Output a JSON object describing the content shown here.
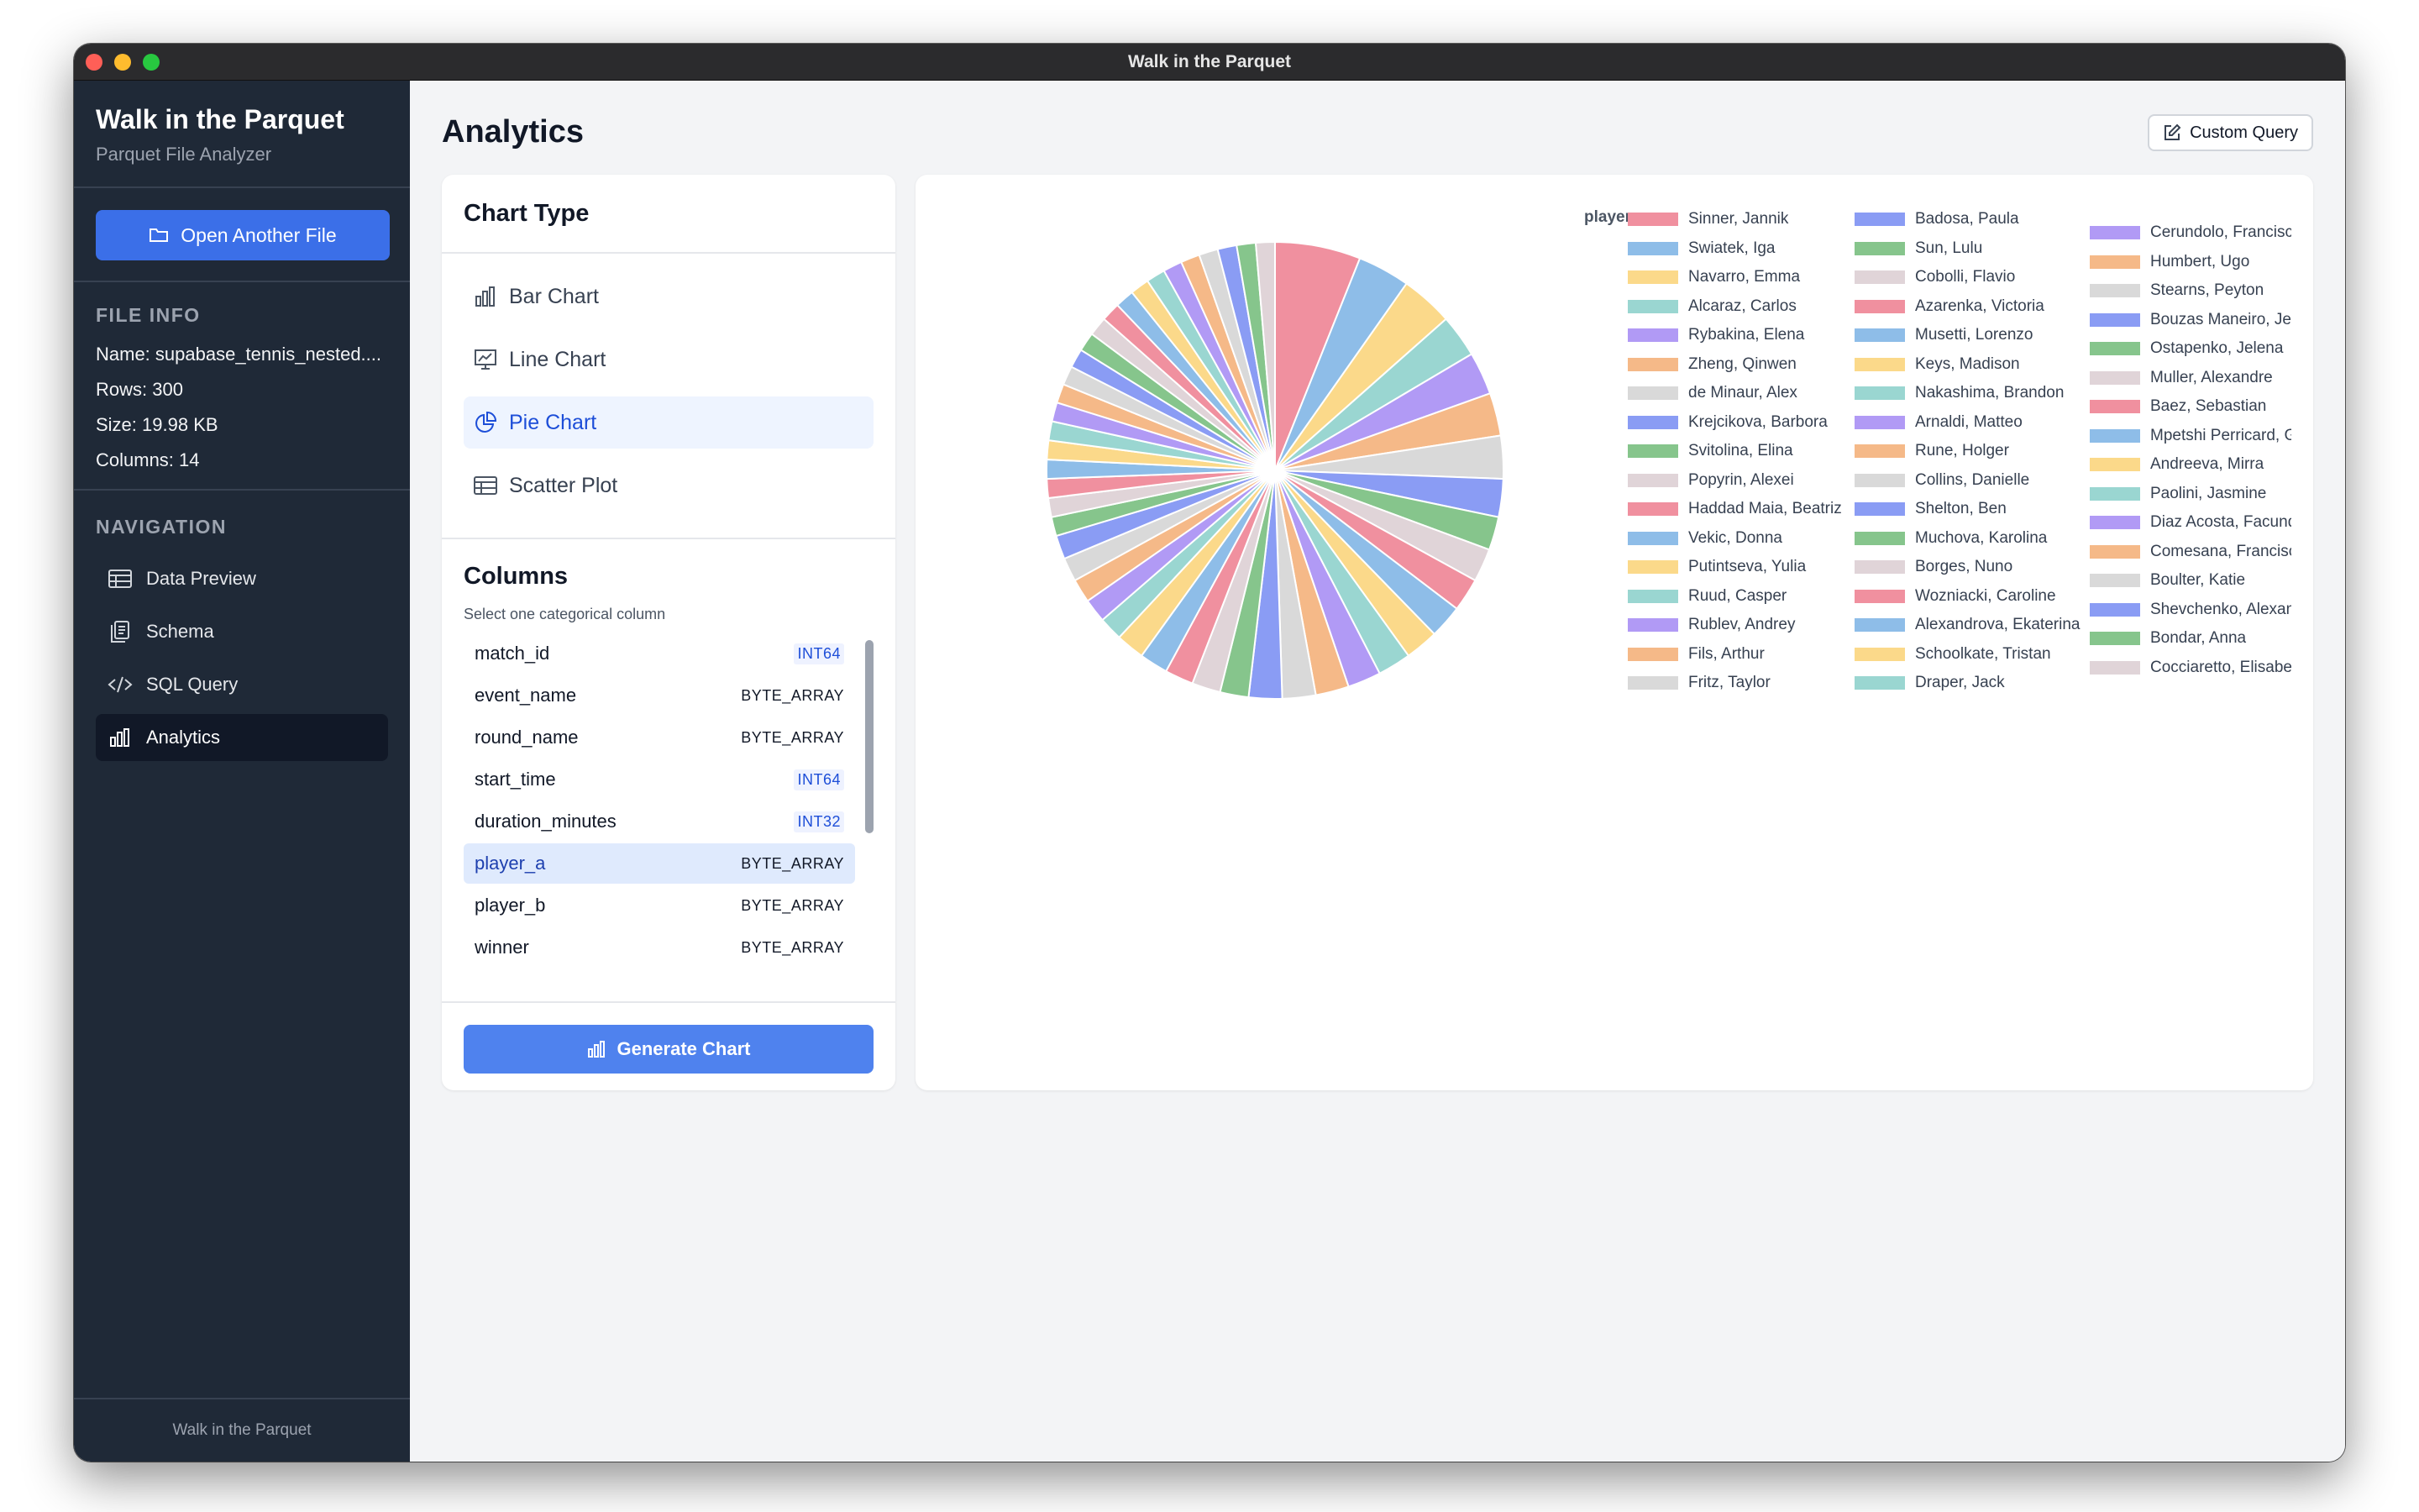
{
  "window": {
    "title": "Walk in the Parquet"
  },
  "sidebar": {
    "title": "Walk in the Parquet",
    "subtitle": "Parquet File Analyzer",
    "open_button": "Open Another File",
    "file_info_title": "FILE INFO",
    "file_info": {
      "name": "Name: supabase_tennis_nested....",
      "rows": "Rows: 300",
      "size": "Size: 19.98 KB",
      "columns": "Columns: 14"
    },
    "nav_title": "NAVIGATION",
    "nav": [
      {
        "label": "Data Preview",
        "icon": "table-icon"
      },
      {
        "label": "Schema",
        "icon": "document-icon"
      },
      {
        "label": "SQL Query",
        "icon": "code-icon"
      },
      {
        "label": "Analytics",
        "icon": "bar-chart-icon",
        "active": true
      }
    ],
    "footer": "Walk in the Parquet"
  },
  "main": {
    "title": "Analytics",
    "custom_query": "Custom Query",
    "chart_type": {
      "title": "Chart Type",
      "options": [
        {
          "label": "Bar Chart",
          "icon": "bar-chart-icon"
        },
        {
          "label": "Line Chart",
          "icon": "line-chart-icon"
        },
        {
          "label": "Pie Chart",
          "icon": "pie-chart-icon",
          "active": true
        },
        {
          "label": "Scatter Plot",
          "icon": "table-icon"
        }
      ]
    },
    "columns": {
      "title": "Columns",
      "subtitle": "Select one categorical column",
      "items": [
        {
          "name": "match_id",
          "type": "INT64"
        },
        {
          "name": "event_name",
          "type": "BYTE_ARRAY"
        },
        {
          "name": "round_name",
          "type": "BYTE_ARRAY"
        },
        {
          "name": "start_time",
          "type": "INT64"
        },
        {
          "name": "duration_minutes",
          "type": "INT32"
        },
        {
          "name": "player_a",
          "type": "BYTE_ARRAY",
          "active": true
        },
        {
          "name": "player_b",
          "type": "BYTE_ARRAY"
        },
        {
          "name": "winner",
          "type": "BYTE_ARRAY"
        }
      ]
    },
    "generate": "Generate Chart"
  },
  "chart_data": {
    "type": "pie",
    "legend_title": "player_a",
    "legend_position": "right",
    "palette": [
      "#f0909f",
      "#8ebde8",
      "#fbd98a",
      "#9ad6d1",
      "#b19af5",
      "#f5b988",
      "#d9d9d9",
      "#8a9cf4",
      "#86c58c",
      "#e0d4d8"
    ],
    "categories": [
      "Sinner, Jannik",
      "Swiatek, Iga",
      "Navarro, Emma",
      "Alcaraz, Carlos",
      "Rybakina, Elena",
      "Zheng, Qinwen",
      "de Minaur, Alex",
      "Krejcikova, Barbora",
      "Svitolina, Elina",
      "Popyrin, Alexei",
      "Haddad Maia, Beatriz",
      "Vekic, Donna",
      "Putintseva, Yulia",
      "Ruud, Casper",
      "Rublev, Andrey",
      "Fils, Arthur",
      "Fritz, Taylor",
      "Badosa, Paula",
      "Sun, Lulu",
      "Cobolli, Flavio",
      "Azarenka, Victoria",
      "Musetti, Lorenzo",
      "Keys, Madison",
      "Nakashima, Brandon",
      "Arnaldi, Matteo",
      "Rune, Holger",
      "Collins, Danielle",
      "Shelton, Ben",
      "Muchova, Karolina",
      "Borges, Nuno",
      "Wozniacki, Caroline",
      "Alexandrova, Ekaterina",
      "Schoolkate, Tristan",
      "Draper, Jack",
      "Cerundolo, Francisco",
      "Humbert, Ugo",
      "Stearns, Peyton",
      "Bouzas Maneiro, Jessica",
      "Ostapenko, Jelena",
      "Muller, Alexandre",
      "Baez, Sebastian",
      "Mpetshi Perricard, Giovanni",
      "Andreeva, Mirra",
      "Paolini, Jasmine",
      "Diaz Acosta, Facundo",
      "Comesana, Francisco",
      "Boulter, Katie",
      "Shevchenko, Alexander",
      "Bondar, Anna",
      "Cocciaretto, Elisabetta"
    ],
    "values": [
      18,
      11,
      11,
      9,
      9,
      9,
      9,
      8,
      7,
      7,
      7,
      7,
      7,
      7,
      7,
      7,
      7,
      7,
      6,
      6,
      6,
      6,
      6,
      5,
      5,
      5,
      5,
      5,
      4,
      4,
      4,
      4,
      4,
      4,
      4,
      4,
      4,
      4,
      4,
      4,
      4,
      4,
      4,
      4,
      4,
      4,
      4,
      4,
      4,
      4
    ]
  }
}
